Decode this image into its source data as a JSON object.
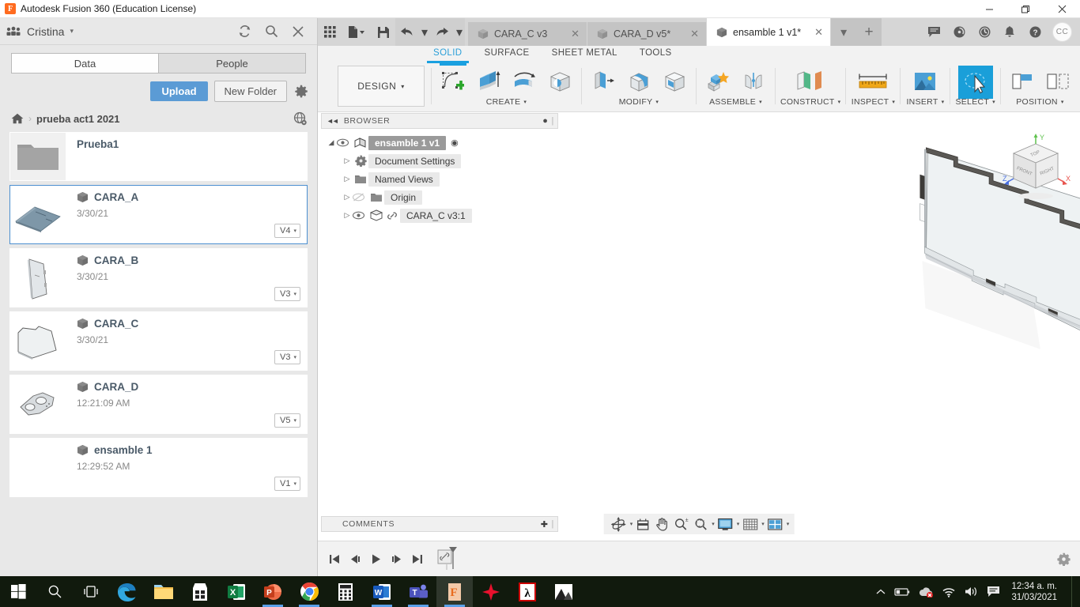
{
  "titlebar": {
    "app_title": "Autodesk Fusion 360 (Education License)",
    "app_icon": "fusion-logo-icon",
    "minimize": "—",
    "maximize": "❐",
    "close": "✕"
  },
  "data_panel": {
    "user_name": "Cristina",
    "user_caret": "▾",
    "refresh_icon": "refresh-icon",
    "search_icon": "search-icon",
    "close_icon": "close-icon",
    "tabs": [
      {
        "label": "Data",
        "active": true
      },
      {
        "label": "People",
        "active": false
      }
    ],
    "upload_label": "Upload",
    "new_folder_label": "New Folder",
    "settings_icon": "gear-icon",
    "breadcrumb": {
      "home_icon": "home-icon",
      "separator": "›",
      "folder_name": "prueba act1 2021",
      "globe_icon": "globe-share-icon"
    },
    "items": [
      {
        "name": "Prueba1",
        "date": "",
        "version": "",
        "type": "folder",
        "selected": false
      },
      {
        "name": "CARA_A",
        "date": "3/30/21",
        "version": "V4",
        "type": "design",
        "selected": true
      },
      {
        "name": "CARA_B",
        "date": "3/30/21",
        "version": "V3",
        "type": "design",
        "selected": false
      },
      {
        "name": "CARA_C",
        "date": "3/30/21",
        "version": "V3",
        "type": "design",
        "selected": false
      },
      {
        "name": "CARA_D",
        "date": "12:21:09 AM",
        "version": "V5",
        "type": "design",
        "selected": false
      },
      {
        "name": "ensamble 1",
        "date": "12:29:52 AM",
        "version": "V1",
        "type": "design",
        "selected": false
      }
    ],
    "version_caret": "▾"
  },
  "quick_access": {
    "grid_icon": "app-grid-icon",
    "file_icon": "new-file-icon",
    "save_icon": "save-icon",
    "undo_icon": "undo-arrow-icon",
    "redo_icon": "redo-arrow-icon",
    "dropdown_caret": "▾"
  },
  "document_tabs": [
    {
      "label": "CARA_C v3",
      "active": false,
      "close": "✕",
      "icon": "design-cube-icon"
    },
    {
      "label": "CARA_D v5*",
      "active": false,
      "close": "✕",
      "icon": "design-cube-icon"
    },
    {
      "label": "ensamble 1 v1*",
      "active": true,
      "close": "✕",
      "icon": "design-cube-icon"
    }
  ],
  "tab_extras": {
    "overflow_caret": "▾",
    "add_tab": "+"
  },
  "header_icons": [
    {
      "name": "comment-icon"
    },
    {
      "name": "job-status-icon"
    },
    {
      "name": "recent-activity-icon"
    },
    {
      "name": "notification-bell-icon"
    },
    {
      "name": "help-icon"
    }
  ],
  "avatar_initials": "CC",
  "ribbon": {
    "workspace_label": "DESIGN",
    "workspace_caret": "▾",
    "tabs": [
      {
        "label": "SOLID",
        "active": true
      },
      {
        "label": "SURFACE",
        "active": false
      },
      {
        "label": "SHEET METAL",
        "active": false
      },
      {
        "label": "TOOLS",
        "active": false
      }
    ],
    "groups": [
      {
        "label": "CREATE",
        "caret": "▾",
        "tools": [
          "create-sketch-icon",
          "extrude-icon",
          "revolve-icon",
          "hole-icon"
        ]
      },
      {
        "label": "MODIFY",
        "caret": "▾",
        "tools": [
          "press-pull-icon",
          "fillet-icon",
          "shell-icon"
        ]
      },
      {
        "label": "ASSEMBLE",
        "caret": "▾",
        "tools": [
          "new-component-icon",
          "joint-icon"
        ]
      },
      {
        "label": "CONSTRUCT",
        "caret": "▾",
        "tools": [
          "offset-plane-icon"
        ]
      },
      {
        "label": "INSPECT",
        "caret": "▾",
        "tools": [
          "measure-ruler-icon"
        ]
      },
      {
        "label": "INSERT",
        "caret": "▾",
        "tools": [
          "insert-image-icon"
        ]
      },
      {
        "label": "SELECT",
        "caret": "▾",
        "tools": [
          "select-cursor-icon"
        ]
      },
      {
        "label": "POSITION",
        "caret": "▾",
        "tools": [
          "align-icon",
          "move-copy-icon"
        ]
      }
    ]
  },
  "browser": {
    "title": "BROWSER",
    "collapse_icon": "collapse-left-icon",
    "minimize_icon": "minimize-panel-icon",
    "grip_icon": "panel-grip-icon",
    "nodes": [
      {
        "label": "ensamble 1 v1",
        "icon": "assembly-icon",
        "arrow": "◢",
        "eye": "visible",
        "root": true,
        "radio": "◉",
        "indent": 0
      },
      {
        "label": "Document Settings",
        "icon": "gear-icon",
        "arrow": "▷",
        "eye": "none",
        "root": false,
        "indent": 1
      },
      {
        "label": "Named Views",
        "icon": "folder-icon",
        "arrow": "▷",
        "eye": "none",
        "root": false,
        "indent": 1
      },
      {
        "label": "Origin",
        "icon": "folder-icon",
        "arrow": "▷",
        "eye": "hidden",
        "root": false,
        "indent": 1
      },
      {
        "label": "CARA_C v3:1",
        "icon": "component-link-icon",
        "arrow": "▷",
        "eye": "visible",
        "root": false,
        "indent": 1
      }
    ]
  },
  "canvas": {
    "model_name": "CARA_C v3:1",
    "viewcube": {
      "faces": [
        "TOP",
        "FRONT",
        "RIGHT"
      ],
      "axes": [
        {
          "label": "X",
          "color": "#e8554f"
        },
        {
          "label": "Y",
          "color": "#5fc24e"
        },
        {
          "label": "Z",
          "color": "#4a6fe0"
        }
      ]
    }
  },
  "comments_bar": {
    "title": "COMMENTS",
    "add_icon": "add-comment-icon",
    "grip_icon": "panel-grip-icon"
  },
  "nav_bar": {
    "tools": [
      {
        "name": "orbit-icon",
        "caret": "▾"
      },
      {
        "name": "look-at-icon",
        "caret": ""
      },
      {
        "name": "pan-hand-icon",
        "caret": ""
      },
      {
        "name": "zoom-icon",
        "caret": ""
      },
      {
        "name": "zoom-window-icon",
        "caret": "▾"
      },
      {
        "name": "display-settings-icon",
        "caret": "▾"
      },
      {
        "name": "grid-snaps-icon",
        "caret": "▾"
      },
      {
        "name": "viewports-icon",
        "caret": "▾"
      }
    ]
  },
  "timeline": {
    "buttons": [
      {
        "name": "go-to-beginning-icon",
        "glyph": "⧏❙"
      },
      {
        "name": "step-back-icon",
        "glyph": "◀❙"
      },
      {
        "name": "play-icon",
        "glyph": "▶"
      },
      {
        "name": "step-forward-icon",
        "glyph": "❙▶"
      },
      {
        "name": "go-to-end-icon",
        "glyph": "❙⧐"
      }
    ],
    "feature_marker": "linked-component-marker-icon",
    "settings_icon": "gear-icon"
  },
  "taskbar": {
    "items": [
      {
        "name": "start-button",
        "icon": "windows-logo-icon",
        "running": false
      },
      {
        "name": "search-button",
        "icon": "search-icon",
        "running": false
      },
      {
        "name": "task-view-button",
        "icon": "task-view-icon",
        "running": false
      },
      {
        "name": "edge-button",
        "icon": "edge-icon",
        "running": false
      },
      {
        "name": "file-explorer-button",
        "icon": "folder-icon",
        "running": true
      },
      {
        "name": "store-button",
        "icon": "microsoft-store-icon",
        "running": false
      },
      {
        "name": "excel-button",
        "icon": "excel-icon",
        "running": false
      },
      {
        "name": "powerpoint-button",
        "icon": "powerpoint-icon",
        "running": true
      },
      {
        "name": "chrome-button",
        "icon": "chrome-icon",
        "running": true
      },
      {
        "name": "calculator-button",
        "icon": "calculator-icon",
        "running": false
      },
      {
        "name": "word-button",
        "icon": "word-icon",
        "running": true
      },
      {
        "name": "teams-button",
        "icon": "teams-icon",
        "running": true
      },
      {
        "name": "fusion360-button",
        "icon": "fusion-logo-icon",
        "running": true,
        "active": true
      },
      {
        "name": "autodesk-button",
        "icon": "autodesk-icon",
        "running": false
      },
      {
        "name": "acrobat-button",
        "icon": "acrobat-reader-icon",
        "running": false
      },
      {
        "name": "photos-button",
        "icon": "photos-icon",
        "running": false
      }
    ],
    "tray": {
      "show_hidden": "show-hidden-icons-chevron",
      "battery": "battery-icon",
      "onedrive": "onedrive-error-icon",
      "wifi": "wifi-icon",
      "volume": "volume-icon",
      "action_center": "action-center-icon",
      "time": "12:34 a. m.",
      "date": "31/03/2021"
    }
  },
  "colors": {
    "accent_blue": "#1aa0e0",
    "upload_blue": "#5b9bd5",
    "panel_bg": "#e8e8e8",
    "ribbon_bg": "#f2f2f2",
    "taskbar_bg": "#111a0d",
    "select_highlight": "#1a9fd9"
  }
}
